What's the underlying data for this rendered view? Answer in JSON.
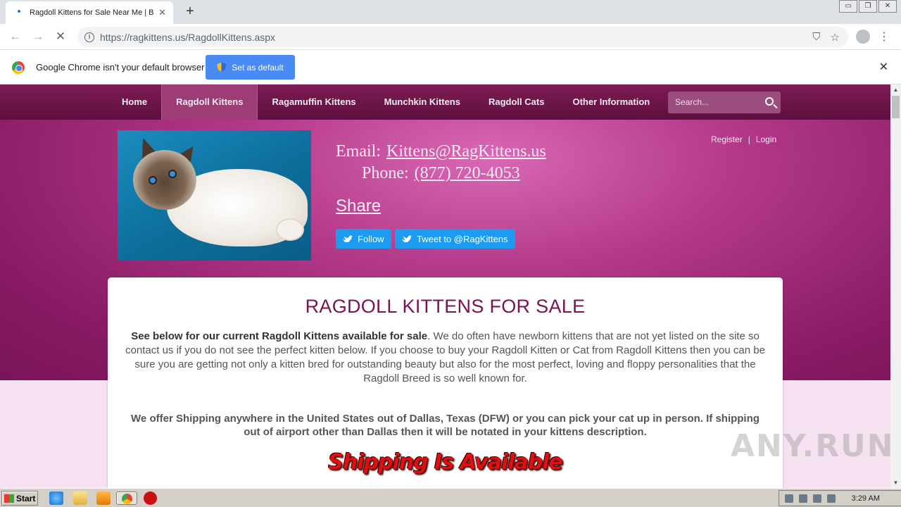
{
  "browser": {
    "tab_title": "Ragdoll Kittens for Sale Near Me | Bu",
    "tab_close": "✕",
    "newtab": "+",
    "window_controls": [
      "▭",
      "❐",
      "✕"
    ],
    "url_host": "https://ragkittens.us",
    "url_path": "/RagdollKittens.aspx",
    "back": "←",
    "forward": "→",
    "reload": "✕",
    "info": "i",
    "star": "☆",
    "blocked": "⛉",
    "menu": "⋮"
  },
  "infobar": {
    "message": "Google Chrome isn't your default browser",
    "button": "Set as default",
    "close": "✕"
  },
  "site": {
    "nav": [
      "Home",
      "Ragdoll Kittens",
      "Ragamuffin Kittens",
      "Munchkin Kittens",
      "Ragdoll Cats",
      "Other Information"
    ],
    "active_index": 1,
    "search_placeholder": "Search...",
    "email_label": "Email:",
    "email": "Kittens@RagKittens.us",
    "phone_label": "Phone:",
    "phone": "(877) 720-4053",
    "share": "Share",
    "follow": "Follow",
    "tweet": "Tweet to @RagKittens",
    "register": "Register",
    "sep": "|",
    "login": "Login"
  },
  "content": {
    "heading": "RAGDOLL KITTENS FOR SALE",
    "intro_bold": "See below for our current Ragdoll Kittens available for sale",
    "intro_rest": ".  We do often have newborn kittens that are not yet listed on the site so contact us if you do not see the perfect kitten below.  If you choose to buy your Ragdoll Kitten or Cat from Ragdoll Kittens then you can be sure you are getting not only a kitten bred for outstanding beauty but also for the most perfect, loving and floppy personalities that the Ragdoll Breed is so well known for.",
    "shipping": "We offer Shipping anywhere in the United States out of Dallas, Texas (DFW) or you can pick your cat up in person.  If shipping out of airport other than Dallas then it will be notated in your kittens description.",
    "banner": "Shipping Is Available"
  },
  "watermark": "ANY.RUN",
  "taskbar": {
    "start": "Start",
    "clock": "3:29 AM"
  },
  "colors": {
    "nav_bg": "#6e1549",
    "hero": "#b43a8a",
    "heading": "#7b1350",
    "twitter": "#1d9bf0",
    "set_default": "#4a8af4"
  }
}
